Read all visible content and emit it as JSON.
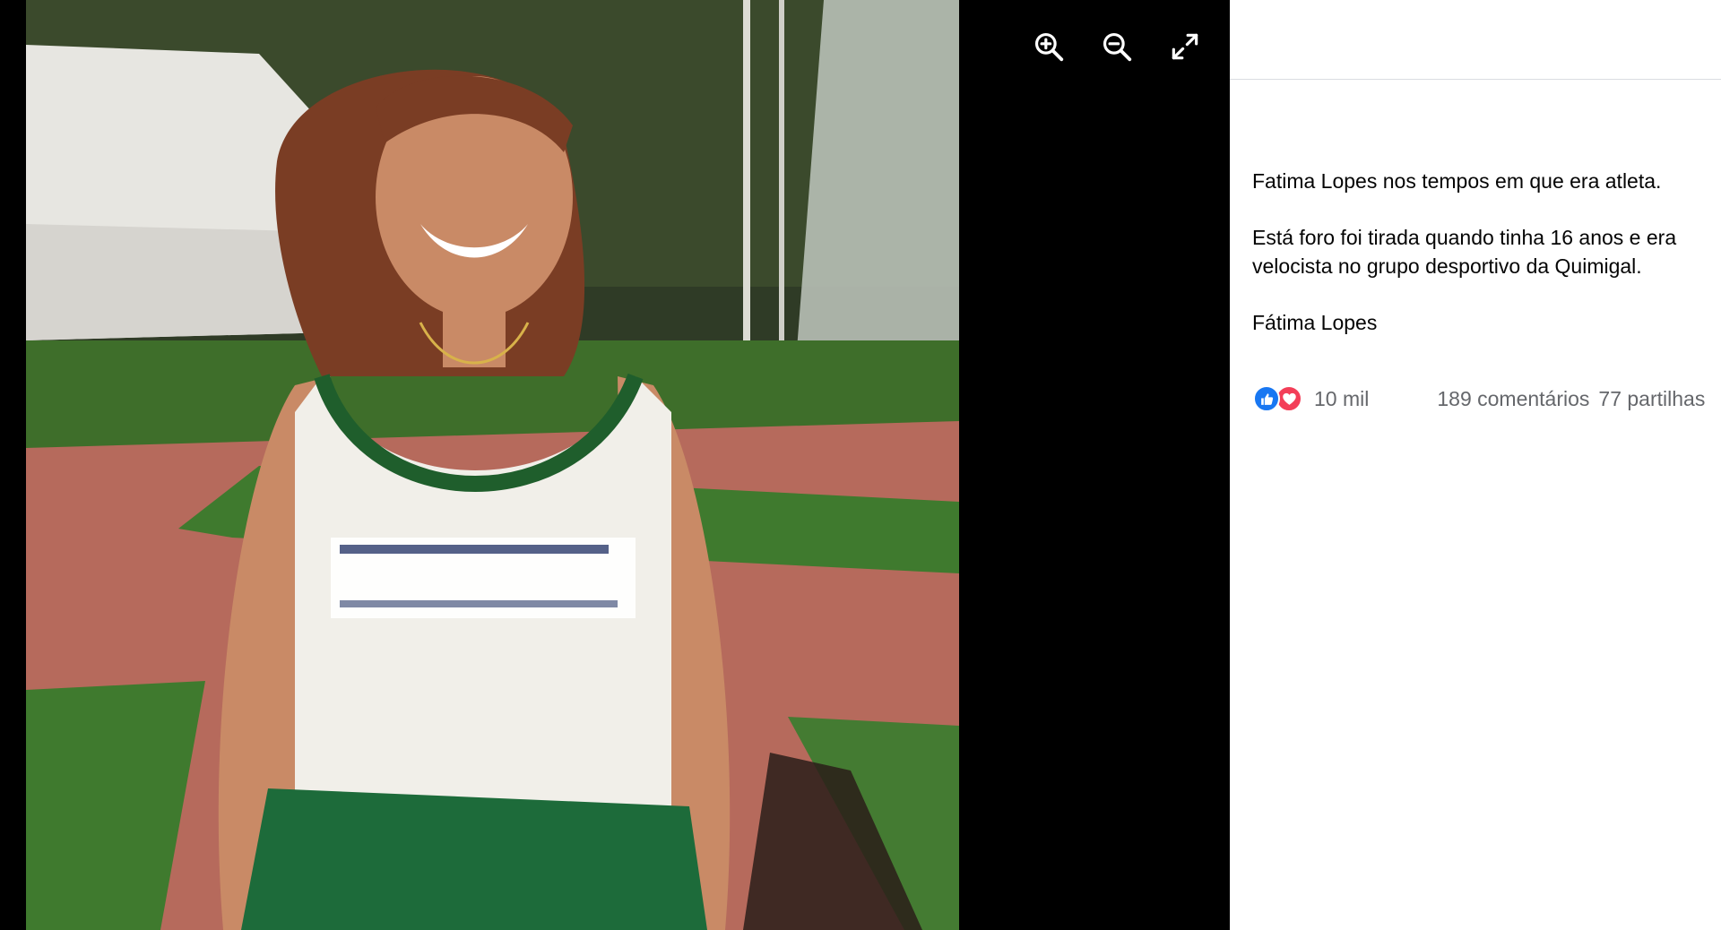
{
  "viewer": {
    "controls": [
      {
        "icon": "zoom-in-icon"
      },
      {
        "icon": "zoom-out-icon"
      },
      {
        "icon": "fullscreen-icon"
      }
    ]
  },
  "post": {
    "paragraphs": [
      "Fatima Lopes nos tempos em que era atleta.",
      "Está foro foi tirada quando tinha 16 anos e era velocista no grupo desportivo da Quimigal.",
      "Fátima Lopes"
    ]
  },
  "reactions": {
    "icons": [
      "like-icon",
      "love-icon"
    ],
    "count": "10 mil",
    "comments": "189 comentários",
    "shares": "77 partilhas"
  },
  "colors": {
    "viewer_bg": "#000000",
    "panel_bg": "#ffffff",
    "text": "#050505",
    "secondary_text": "#65676b",
    "like": "#1877f2",
    "love": "#f33e58"
  }
}
